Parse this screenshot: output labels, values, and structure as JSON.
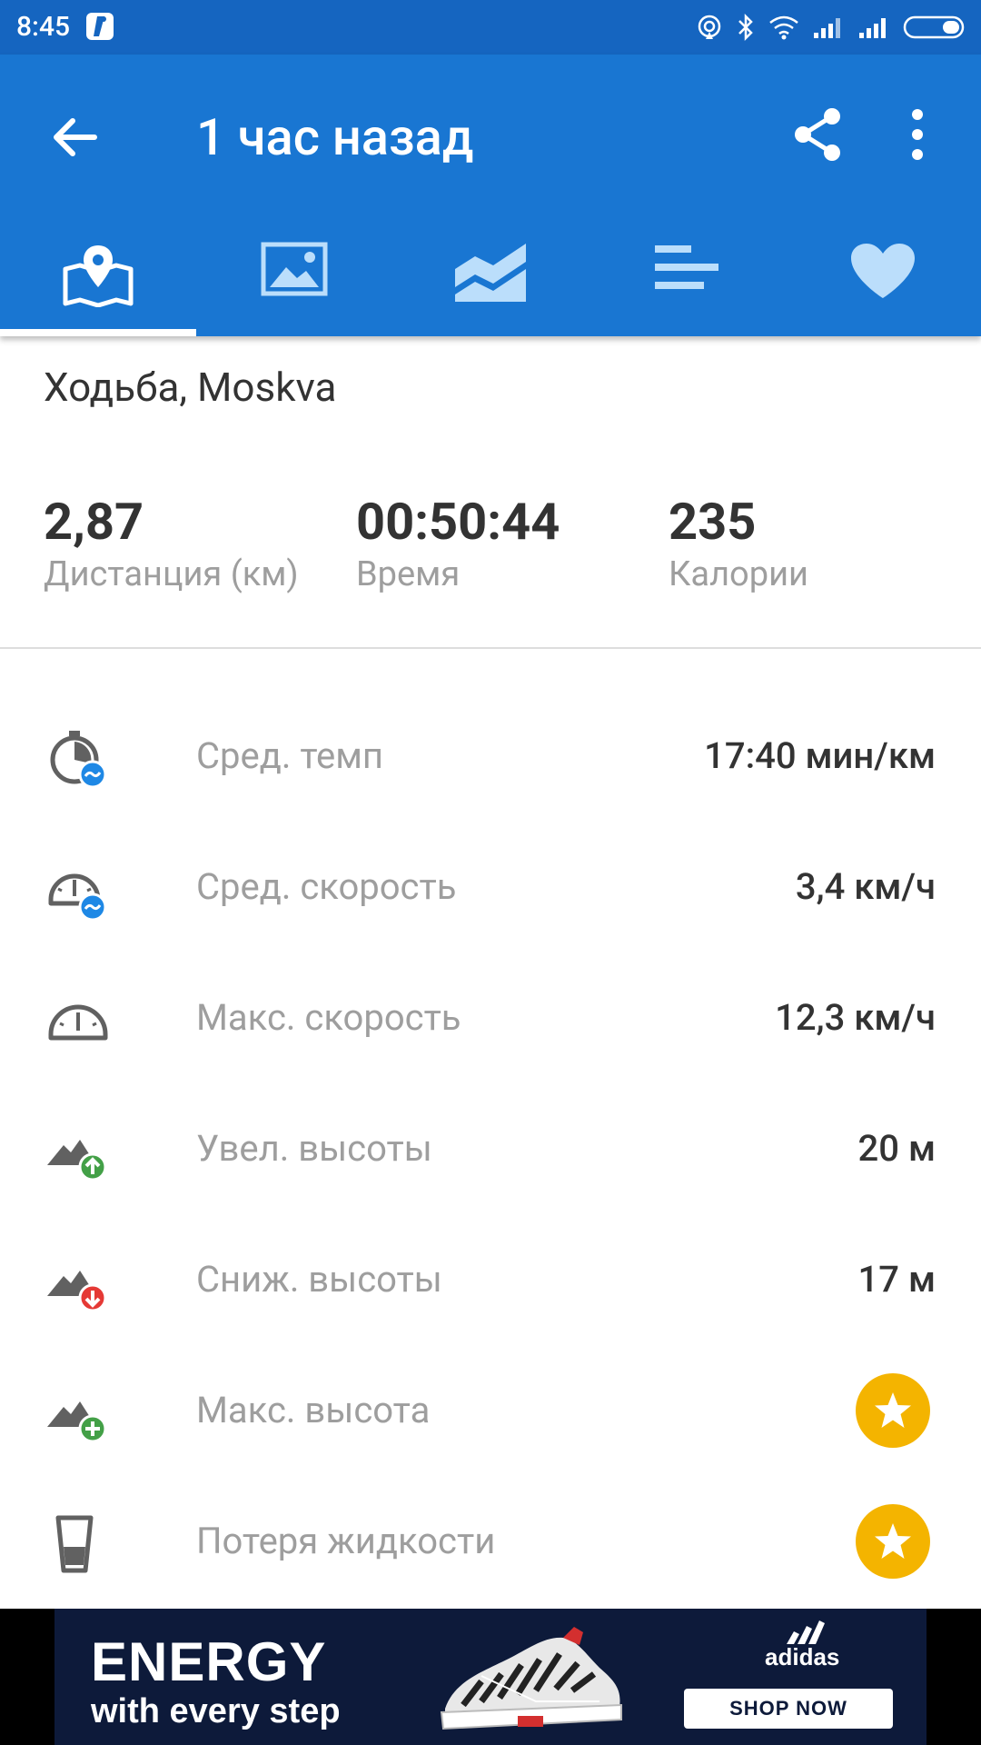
{
  "status_bar": {
    "time": "8:45",
    "icons": [
      "hotspot-icon",
      "bluetooth-icon",
      "wifi-icon",
      "signal-icon",
      "signal-icon",
      "battery-icon"
    ]
  },
  "app_bar": {
    "title": "1 час назад",
    "back_icon": "arrow-back-icon",
    "share_icon": "share-icon",
    "more_icon": "more-vert-icon"
  },
  "tabs": [
    {
      "icon": "map-pin-icon",
      "selected": true
    },
    {
      "icon": "photo-icon",
      "selected": false
    },
    {
      "icon": "area-chart-icon",
      "selected": false
    },
    {
      "icon": "bar-list-icon",
      "selected": false
    },
    {
      "icon": "heart-icon",
      "selected": false
    }
  ],
  "activity": {
    "title": "Ходьба, Moskva"
  },
  "summary": [
    {
      "value": "2,87",
      "label": "Дистанция (км)"
    },
    {
      "value": "00:50:44",
      "label": "Время"
    },
    {
      "value": "235",
      "label": "Калории"
    }
  ],
  "stats": [
    {
      "icon": "avg-pace-icon",
      "label": "Сред. темп",
      "value": "17:40 мин/км"
    },
    {
      "icon": "avg-speed-icon",
      "label": "Сред. скорость",
      "value": "3,4 км/ч"
    },
    {
      "icon": "max-speed-icon",
      "label": "Макс. скорость",
      "value": "12,3 км/ч"
    },
    {
      "icon": "elevation-gain-icon",
      "label": "Увел. высоты",
      "value": "20 м"
    },
    {
      "icon": "elevation-loss-icon",
      "label": "Сниж. высоты",
      "value": "17 м"
    },
    {
      "icon": "max-elevation-icon",
      "label": "Макс. высота",
      "value": "",
      "premium": true
    },
    {
      "icon": "water-loss-icon",
      "label": "Потеря жидкости",
      "value": "",
      "premium": true
    }
  ],
  "ad": {
    "headline": "ENERGY",
    "subline": "with every step",
    "brand": "adidas",
    "cta": "SHOP NOW"
  },
  "colors": {
    "status_bar": "#1565c0",
    "app_bar": "#1976d2",
    "tab_inactive": "#bbdefb",
    "label_gray": "#9e9e9e",
    "value_dark": "#333333",
    "premium_star": "#f4b400",
    "icon_blue": "#1e88e5",
    "icon_green": "#43a047",
    "icon_red": "#e53935"
  }
}
